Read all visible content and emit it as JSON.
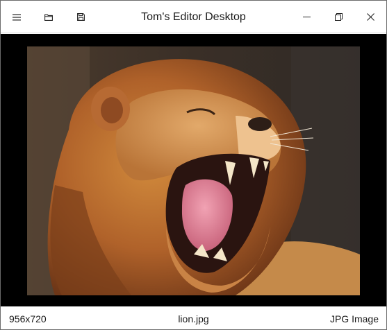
{
  "window": {
    "title": "Tom's Editor Desktop",
    "icons": {
      "menu": "hamburger-icon",
      "open": "folder-icon",
      "save": "floppy-disk-icon",
      "minimize": "minimize-icon",
      "restore": "restore-icon",
      "close": "close-icon"
    }
  },
  "viewer": {
    "image_subject": "lion",
    "background_color": "#000000"
  },
  "status": {
    "dimensions": "956x720",
    "filename": "lion.jpg",
    "filetype": "JPG Image"
  }
}
